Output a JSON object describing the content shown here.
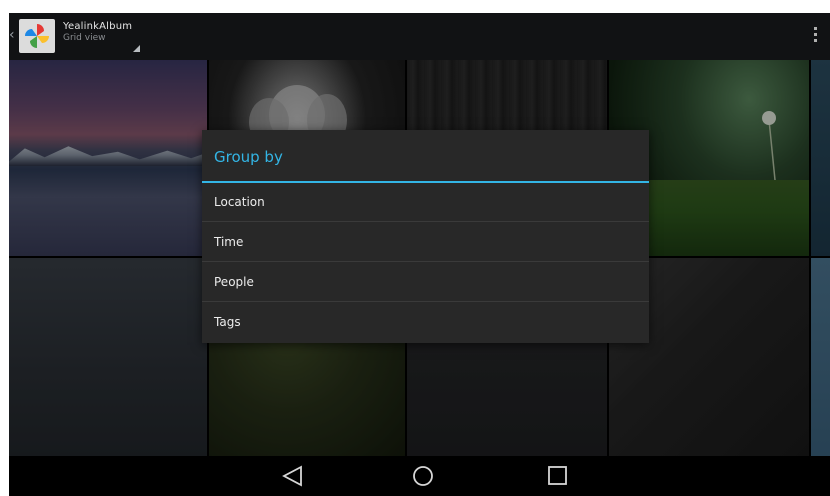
{
  "action_bar": {
    "app_title": "YealinkAlbum",
    "view_subtitle": "Grid view",
    "app_icon": "pinwheel-photos-icon",
    "overflow_icon": "overflow-menu-icon"
  },
  "dialog": {
    "title": "Group by",
    "accent_color": "#33b5e5",
    "options": [
      {
        "label": "Location"
      },
      {
        "label": "Time"
      },
      {
        "label": "People"
      },
      {
        "label": "Tags"
      }
    ]
  },
  "nav_bar": {
    "back_icon": "back-triangle-icon",
    "home_icon": "home-circle-icon",
    "recents_icon": "recents-square-icon"
  }
}
